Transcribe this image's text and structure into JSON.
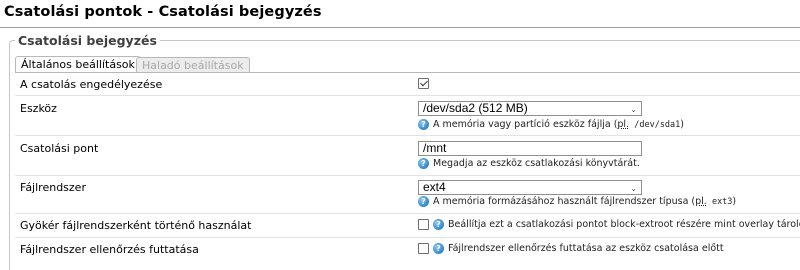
{
  "page": {
    "title": "Csatolási pontok - Csatolási bejegyzés"
  },
  "section": {
    "legend": "Csatolási bejegyzés"
  },
  "tabs": [
    {
      "label": "Általános beállítások",
      "active": true
    },
    {
      "label": "Haladó beállítások",
      "active": false
    }
  ],
  "fields": {
    "enable": {
      "label": "A csatolás engedélyezése",
      "checked": true
    },
    "device": {
      "label": "Eszköz",
      "value": "/dev/sda2 (512 MB)",
      "help_prefix": "A memória vagy partíció eszköz fájlja (",
      "help_abbr": "pl.",
      "help_code": " /dev/sda1",
      "help_suffix": ")"
    },
    "mountpoint": {
      "label": "Csatolási pont",
      "value": "/mnt",
      "help": "Megadja az eszköz csatlakozási könyvtárát."
    },
    "filesystem": {
      "label": "Fájlrendszer",
      "value": "ext4",
      "help_prefix": "A memória formázásához használt fájlrendszer típusa (",
      "help_abbr": "pl.",
      "help_code": " ext3",
      "help_suffix": ")"
    },
    "rootfs": {
      "label": "Gyökér fájlrendszerként történő használat",
      "checked": false,
      "help": "Beállítja ezt a csatlakozási pontot block-extroot részére mint overlay tároló"
    },
    "fscheck": {
      "label": "Fájlrendszer ellenőrzés futtatása",
      "checked": false,
      "help": "Fájlrendszer ellenőrzés futtatása az eszköz csatolása előtt"
    }
  },
  "icons": {
    "help": "help-circle-icon",
    "dropdown": "chevron-down-icon",
    "check": "checkmark-icon"
  },
  "colors": {
    "help_icon": "#2d86c9",
    "border": "#c6c6c6",
    "inactive_tab": "#ececec"
  }
}
